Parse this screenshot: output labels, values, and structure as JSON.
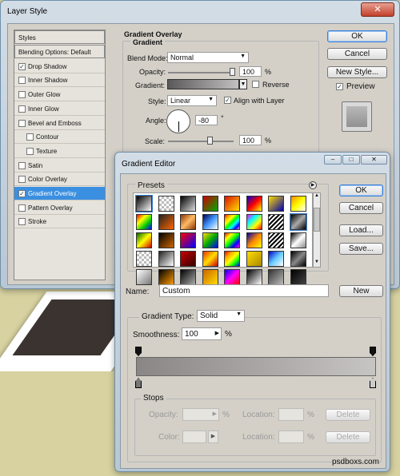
{
  "layer_style": {
    "title": "Layer Style",
    "sidebar": {
      "items": [
        {
          "label": "Styles",
          "check": false
        },
        {
          "label": "Blending Options: Default",
          "check": false
        },
        {
          "label": "Drop Shadow",
          "check": true,
          "checked": true
        },
        {
          "label": "Inner Shadow",
          "check": true,
          "checked": false
        },
        {
          "label": "Outer Glow",
          "check": true,
          "checked": false
        },
        {
          "label": "Inner Glow",
          "check": true,
          "checked": false
        },
        {
          "label": "Bevel and Emboss",
          "check": true,
          "checked": false
        },
        {
          "label": "Contour",
          "check": true,
          "checked": false
        },
        {
          "label": "Texture",
          "check": true,
          "checked": false
        },
        {
          "label": "Satin",
          "check": true,
          "checked": false
        },
        {
          "label": "Color Overlay",
          "check": true,
          "checked": false
        },
        {
          "label": "Gradient Overlay",
          "check": true,
          "checked": true
        },
        {
          "label": "Pattern Overlay",
          "check": true,
          "checked": false
        },
        {
          "label": "Stroke",
          "check": true,
          "checked": false
        }
      ]
    },
    "section_title": "Gradient Overlay",
    "group_title": "Gradient",
    "blend_mode_label": "Blend Mode:",
    "blend_mode": "Normal",
    "opacity_label": "Opacity:",
    "opacity": "100",
    "opacity_unit": "%",
    "gradient_label": "Gradient:",
    "reverse_label": "Reverse",
    "style_label": "Style:",
    "style": "Linear",
    "align_label": "Align with Layer",
    "angle_label": "Angle:",
    "angle": "-80",
    "angle_unit": "°",
    "scale_label": "Scale:",
    "scale": "100",
    "scale_unit": "%",
    "ok": "OK",
    "cancel": "Cancel",
    "new_style": "New Style...",
    "preview_label": "Preview"
  },
  "gradient_editor": {
    "title": "Gradient Editor",
    "presets_label": "Presets",
    "ok": "OK",
    "cancel": "Cancel",
    "load": "Load...",
    "save": "Save...",
    "name_label": "Name:",
    "name": "Custom",
    "new": "New",
    "type_label": "Gradient Type:",
    "type": "Solid",
    "smoothness_label": "Smoothness:",
    "smoothness": "100",
    "smoothness_unit": "%",
    "stops_label": "Stops",
    "opacity_label": "Opacity:",
    "opacity_unit": "%",
    "location_label": "Location:",
    "location_unit": "%",
    "delete": "Delete",
    "color_label": "Color:"
  },
  "watermark": "psdboxs.com",
  "colors": {
    "selected": "#3b8fe0",
    "accent": "#3b7fd6"
  }
}
